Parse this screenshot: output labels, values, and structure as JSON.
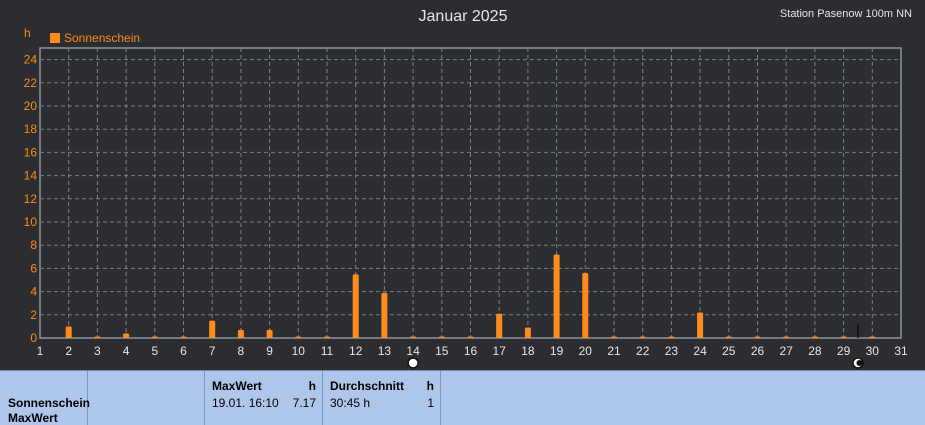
{
  "header": {
    "title": "Januar 2025",
    "station": "Station Pasenow 100m NN"
  },
  "colors": {
    "accent": "#ff8c1a",
    "background": "#2b2d31",
    "summary_bg": "#aec6ea"
  },
  "chart_data": {
    "type": "bar",
    "title": "Januar 2025",
    "ylabel": "h",
    "xlabel": "",
    "ylim": [
      0,
      25
    ],
    "yticks": [
      "0",
      "2",
      "4",
      "6",
      "8",
      "10",
      "12",
      "14",
      "16",
      "18",
      "20",
      "22",
      "24"
    ],
    "categories": [
      "1",
      "2",
      "3",
      "4",
      "5",
      "6",
      "7",
      "8",
      "9",
      "10",
      "11",
      "12",
      "13",
      "14",
      "15",
      "16",
      "17",
      "18",
      "19",
      "20",
      "21",
      "22",
      "23",
      "24",
      "25",
      "26",
      "27",
      "28",
      "29",
      "30",
      "31"
    ],
    "series": [
      {
        "name": "Sonnenschein",
        "color": "#ff8c1a",
        "x": [
          2,
          3,
          4,
          5,
          6,
          7,
          8,
          9,
          10,
          11,
          12,
          13,
          14,
          15,
          16,
          17,
          18,
          19,
          20,
          21,
          22,
          23,
          24,
          25,
          26,
          27,
          28,
          29,
          30
        ],
        "values": [
          1.0,
          0.1,
          0.4,
          0,
          0,
          1.5,
          0.7,
          0.7,
          0,
          0,
          5.5,
          3.9,
          0,
          0,
          0,
          2.1,
          0.9,
          7.2,
          5.6,
          0,
          0,
          0,
          2.2,
          0,
          0,
          0,
          0,
          0,
          0
        ]
      }
    ],
    "grid": true,
    "legend": "top-left",
    "moon_markers": [
      {
        "day": 14,
        "phase": "full-moon"
      },
      {
        "day": 29.5,
        "phase": "new-moon"
      }
    ]
  },
  "summary": {
    "row_label_1": "Sonnenschein",
    "row_label_2": "MaxWert",
    "max_header": "MaxWert",
    "max_unit": "h",
    "max_time": "19.01.  16:10",
    "max_value": "7.17",
    "avg_header": "Durchschnitt",
    "avg_unit": "h",
    "avg_value": "30:45 h",
    "avg_extra": "1"
  }
}
